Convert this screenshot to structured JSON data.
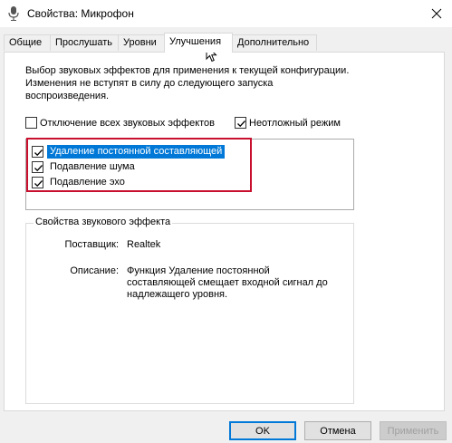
{
  "window": {
    "title": "Свойства: Микрофон"
  },
  "tabs": [
    {
      "label": "Общие"
    },
    {
      "label": "Прослушать"
    },
    {
      "label": "Уровни"
    },
    {
      "label": "Улучшения"
    },
    {
      "label": "Дополнительно"
    }
  ],
  "active_tab": "Улучшения",
  "enhancements": {
    "intro": "Выбор звуковых эффектов для применения к текущей конфигурации. Изменения не вступят в силу до следующего запуска воспроизведения.",
    "disable_all": {
      "label": "Отключение всех звуковых эффектов",
      "checked": false
    },
    "immediate_mode": {
      "label": "Неотложный режим",
      "checked": true
    },
    "effects": [
      {
        "label": "Удаление постоянной составляющей",
        "checked": true,
        "selected": true
      },
      {
        "label": "Подавление шума",
        "checked": true,
        "selected": false
      },
      {
        "label": "Подавление эхо",
        "checked": true,
        "selected": false
      }
    ],
    "properties": {
      "group_title": "Свойства звукового эффекта",
      "provider_label": "Поставщик:",
      "provider_value": "Realtek",
      "description_label": "Описание:",
      "description_lines": [
        "Функция Удаление постоянной",
        "составляющей смещает входной сигнал до",
        "надлежащего уровня."
      ]
    }
  },
  "buttons": {
    "ok": "OK",
    "cancel": "Отмена",
    "apply": "Применить"
  },
  "colors": {
    "selection": "#0078d7",
    "highlight_frame": "#c8102e"
  },
  "icons": {
    "title": "microphone-icon",
    "close": "close-icon",
    "check": "checkmark-icon",
    "pointer": "mouse-cursor-icon"
  }
}
